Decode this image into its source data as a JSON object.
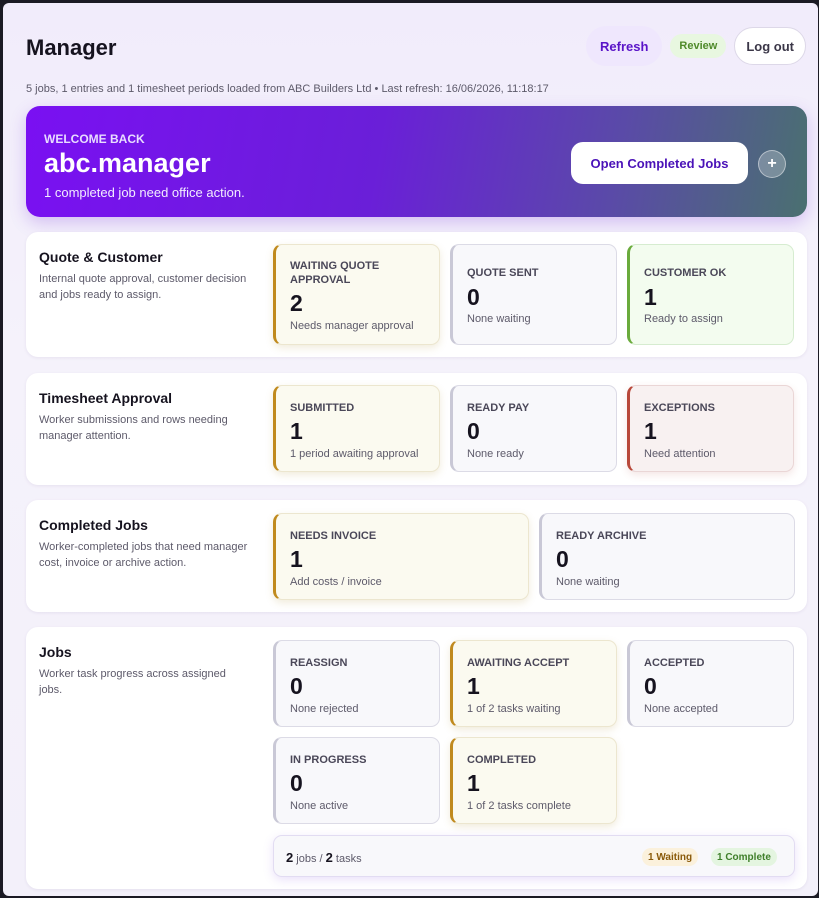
{
  "header": {
    "title": "Manager",
    "subtitle": "5 jobs, 1 entries and 1 timesheet periods loaded from ABC Builders Ltd • Last refresh: 16/06/2026, 11:18:17",
    "refresh_label": "Refresh",
    "review_badge": "Review",
    "logout_label": "Log out"
  },
  "welcome": {
    "kicker": "WELCOME BACK",
    "name": "abc.manager",
    "message": "1 completed job need office action.",
    "open_button": "Open Completed Jobs",
    "plus_icon": "+"
  },
  "sections": {
    "quote": {
      "title": "Quote & Customer",
      "desc": "Internal quote approval, customer decision and jobs ready to assign.",
      "cards": [
        {
          "label": "WAITING QUOTE APPROVAL",
          "value": "2",
          "sub": "Needs manager approval"
        },
        {
          "label": "QUOTE SENT",
          "value": "0",
          "sub": "None waiting"
        },
        {
          "label": "CUSTOMER OK",
          "value": "1",
          "sub": "Ready to assign"
        }
      ]
    },
    "timesheet": {
      "title": "Timesheet Approval",
      "desc": "Worker submissions and rows needing manager attention.",
      "cards": [
        {
          "label": "SUBMITTED",
          "value": "1",
          "sub": "1 period awaiting approval"
        },
        {
          "label": "READY PAY",
          "value": "0",
          "sub": "None ready"
        },
        {
          "label": "EXCEPTIONS",
          "value": "1",
          "sub": "Need attention"
        }
      ]
    },
    "completed": {
      "title": "Completed Jobs",
      "desc": "Worker-completed jobs that need manager cost, invoice or archive action.",
      "cards": [
        {
          "label": "NEEDS INVOICE",
          "value": "1",
          "sub": "Add costs / invoice"
        },
        {
          "label": "READY ARCHIVE",
          "value": "0",
          "sub": "None waiting"
        }
      ]
    },
    "jobs": {
      "title": "Jobs",
      "desc": "Worker task progress across assigned jobs.",
      "cards": [
        {
          "label": "REASSIGN",
          "value": "0",
          "sub": "None rejected"
        },
        {
          "label": "AWAITING ACCEPT",
          "value": "1",
          "sub": "1 of 2 tasks waiting"
        },
        {
          "label": "ACCEPTED",
          "value": "0",
          "sub": "None accepted"
        },
        {
          "label": "IN PROGRESS",
          "value": "0",
          "sub": "None active"
        },
        {
          "label": "COMPLETED",
          "value": "1",
          "sub": "1 of 2 tasks complete"
        }
      ],
      "summary": {
        "jobs_count": "2",
        "jobs_word": " jobs / ",
        "tasks_count": "2",
        "tasks_word": " tasks",
        "waiting_pill": "1 Waiting",
        "complete_pill": "1 Complete"
      }
    }
  },
  "colors": {
    "accent": "#7a10f2",
    "warning_border": "#c08a1e",
    "success_border": "#6aab3c",
    "danger_border": "#b8483a"
  }
}
